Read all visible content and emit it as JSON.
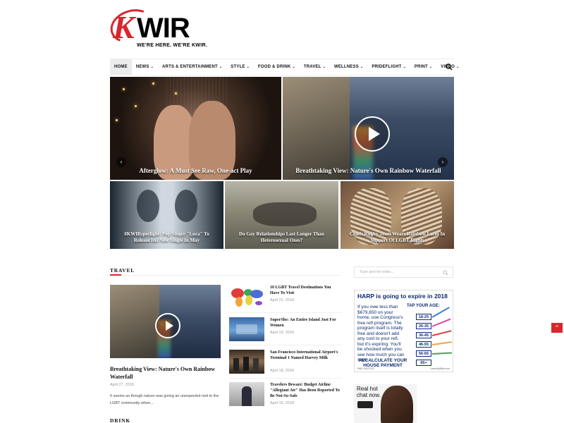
{
  "logo": {
    "letter_k": "K",
    "letters": "WIR",
    "tagline": "WE'RE HERE. WE'RE KWIR."
  },
  "nav": {
    "items": [
      "HOME",
      "NEWS",
      "ARTS & ENTERTAINMENT",
      "STYLE",
      "FOOD & DRINK",
      "TRAVEL",
      "WELLNESS",
      "PRIDEFLIGHT",
      "PRINT",
      "VIDEO"
    ],
    "dropdown_caret": "⌄",
    "active": "HOME",
    "search_icon": "search-icon"
  },
  "hero": {
    "main": [
      {
        "title": "Afterglow: A Must See Raw, One-act Play"
      },
      {
        "title": "Breathtaking View: Nature's Own Rainbow Waterfall"
      }
    ],
    "tiles": [
      {
        "title": "#KWIRspotlight: Pop Singer \"Luca\" To Release His New Single In May"
      },
      {
        "title": "Do Gay Relationships Last Longer Than Heterosexual Ones?"
      },
      {
        "title": "Chiefs Rugby Team Wears Rainbow Laces In Support Of LGBT Rights"
      }
    ],
    "arrow_left": "‹",
    "arrow_right": "›"
  },
  "travel": {
    "heading": "TRAVEL",
    "featured": {
      "title": "Breathtaking View: Nature's Own Rainbow Waterfall",
      "date": "April 27, 2018",
      "excerpt": "It seems as though nature was giving an unexpected nod to the LGBT community when..."
    },
    "list": [
      {
        "title": "10 LGBT Travel Destinations You Have To Visit",
        "date": "April 22, 2018"
      },
      {
        "title": "SuperShe: An Entire Island Just For Women",
        "date": "April 19, 2018"
      },
      {
        "title": "San Francisco International Airport's Terminal 1 Named Harvey Milk",
        "date": "April 18, 2018"
      },
      {
        "title": "Travelers Beware: Budget Airline \"Allegiant Air\" Has Been Reported To Be Not-So-Safe",
        "date": "April 16, 2018"
      }
    ]
  },
  "drink": {
    "heading": "DRINK"
  },
  "sidebar": {
    "search_placeholder": "Type and hit enter...",
    "ad1": {
      "headline": "HARP is going to expire in 2018",
      "body": "If you owe less than $679,650 on your home, use Congress's free refi program. The program itself is totally free and doesn't add any cost to your refi, but it's expiring. You'll be shocked when you see how much you can save",
      "age_label": "TAP YOUR AGE:",
      "ages": [
        "18-25",
        "26-35",
        "36-45",
        "46-55",
        "56-65",
        "65+"
      ],
      "cta": "RECALCULATE YOUR HOUSE PAYMENT",
      "fine_left": "PAID HOSTED",
      "fine_right": "LowerMyBills.com"
    },
    "ad2": {
      "line1": "Real hot",
      "line2": "chat now."
    }
  },
  "back_to_top": "^"
}
